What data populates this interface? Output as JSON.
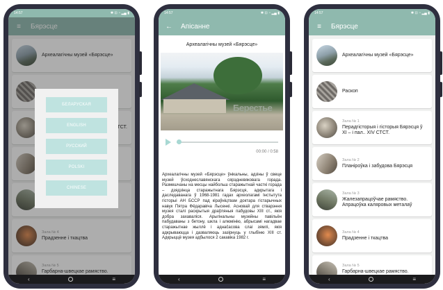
{
  "colors": {
    "accent": "#8fb9ae",
    "language_button": "#bfe3e0",
    "frame": "#2e2f3f"
  },
  "status": {
    "time": "14:57",
    "icons": "✱ ⊡ ◔ ▂▄ ▮"
  },
  "screen1": {
    "title": "Бярэсце",
    "menu_icon": "menu-icon",
    "languages": [
      "БЕЛАРУСКАЯ",
      "ENGLISH",
      "РУССКИЙ",
      "POLSKI",
      "CHINESE"
    ],
    "items": [
      {
        "sub": "",
        "text": "Археалагічны музей «Бярэсце»"
      },
      {
        "sub": "",
        "text": ""
      },
      {
        "sub": "",
        "text": "СТСТ."
      },
      {
        "sub": "",
        "text": ""
      },
      {
        "sub": "",
        "text": ""
      },
      {
        "sub": "Зала № 4",
        "text": "Прадзенне і ткацтва"
      },
      {
        "sub": "Зала № 5",
        "text": "Гарбарна-швецкае рамяство. Кастарэзнае рамяство"
      }
    ]
  },
  "screen2": {
    "title": "Апісанне",
    "heading": "Археалагічны музей «Бярэсце»",
    "sign_text": "Берестье",
    "time": "00:00 / 0:58",
    "body": "Археалагічны музей «Бярэсце» ўнікальны, адзіны ў свеце музей ўсходнеславянскага сярэдневяковага горада. Размешчаны на месцы найбольш старажытнай часткі горада – дзядзінца старажытнага Бярэсця, адкрытага і даследаванага ў 1968-1981 гадах археолагамі Інстытута гісторыі АН БССР пад кіраўніцтвам доктара гістарычных навук Пятра Фёдаравіча Лысенкі. Асновай для стварэння музея сталі раскрытыя драўляныя пабудовы XIII ст., якія добра захаваліся. Арыгінальны музейны павільён пабудаваны з бетону, шкла і алюмінію, абрысамі нагадвае старажытнае жыллё і аднačасова слаі зямлі, якія адкрываюцца і дазваляюць зазірнуць у глыбіню XIII ст. Адкрыццё музея адбылося 2 сакавіка 1982 г."
  },
  "screen3": {
    "title": "Бярэсце",
    "items": [
      {
        "sub": "",
        "text": "Археалагічны музей «Бярэсце»"
      },
      {
        "sub": "",
        "text": "Раскоп"
      },
      {
        "sub": "Зала № 1",
        "text": "Перадгісторыя і гісторыя Бярэсця ў XI – і пал.. XIV СТСТ."
      },
      {
        "sub": "Зала № 2",
        "text": "Планіроўка і забудова Бярэсця"
      },
      {
        "sub": "Зала № 3",
        "text": "Жалезапрацоўчае рамяство. Апрацоўка каляровых металаў"
      },
      {
        "sub": "Зала № 4",
        "text": "Прадзенне і ткацтва"
      },
      {
        "sub": "Зала № 5",
        "text": "Гарбарна-швецкае рамяство. Кастарэзнае рамяство"
      }
    ]
  },
  "nav": {
    "back": "‹",
    "home_icon": "home-circle-icon",
    "recents": "≡"
  }
}
